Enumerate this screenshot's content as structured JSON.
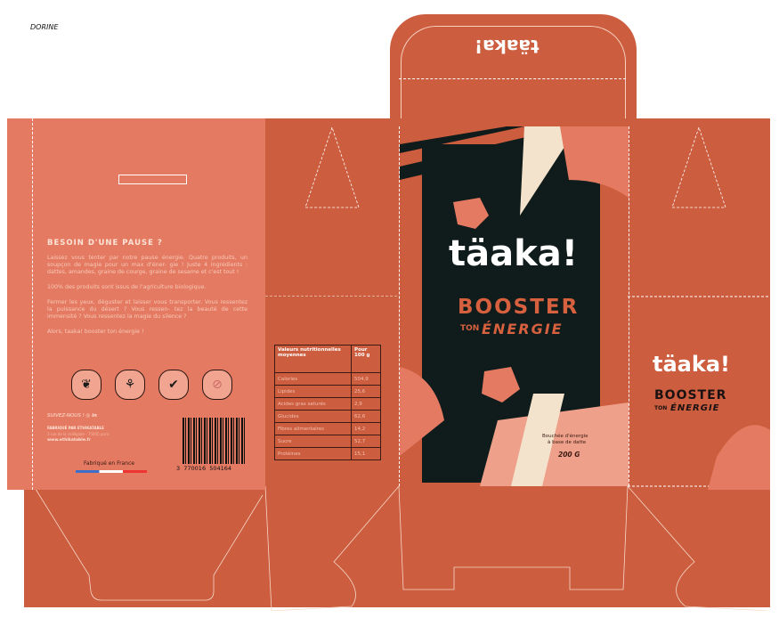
{
  "author": "DORINE",
  "colors": {
    "dieline": "#cc5d3e",
    "panel": "#e57a62",
    "dark": "#0f1c1b",
    "cream": "#f4e3cc",
    "pink": "#eea08a"
  },
  "back_panel": {
    "title": "BESOIN D'UNE PAUSE ?",
    "paragraphs": [
      "Laissez vous tenter par notre pause énergie. Quatre produits, un soupçon de magie pour un max d'éner- gie ! Juste 4 ingrédients : dattes, amandes, graine de courge, graine de sesame et c'est tout !",
      "100% des produits sont issus de l'agriculture biologique.",
      "Fermer les yeux, déguster et laisser vous transporter. Vous ressentez la puissance du désert ? Vous ressen- tez la beauté de cette immensité ? Vous ressentez la magie du silence ?",
      "Alors, taaka! booster ton énergie !"
    ],
    "badges": [
      {
        "icon": "vegan-leaf-icon",
        "label": "Vegan"
      },
      {
        "icon": "wheat-icon",
        "label": "Sans gluten"
      },
      {
        "icon": "check-icon",
        "label": "Biologique"
      },
      {
        "icon": "no-sugar-icon",
        "label": "Sans sucre ajouté"
      }
    ],
    "follow": "SUIVEZ-NOUS !",
    "maker": "FABRIQUÉ PAR ETHIKATABLE",
    "address": "3 rue de la collégiale - 75005 paris",
    "website": "www.ethikatable.fr",
    "made_in": "Fabriqué en France",
    "barcode": "3  770016  504164"
  },
  "nutrition": {
    "header": [
      "Valeurs nutritionnelles moyennes",
      "Pour 100 g"
    ],
    "rows": [
      [
        "Calories",
        "504,9"
      ],
      [
        "Lipides",
        "25,6"
      ],
      [
        "Acides gras saturés",
        "2,9"
      ],
      [
        "Glucides",
        "62,6"
      ],
      [
        "Fibres alimentaires",
        "14,2"
      ],
      [
        "Sucre",
        "52,7"
      ],
      [
        "Protéines",
        "15,1"
      ]
    ]
  },
  "front": {
    "logo": "täaka!",
    "booster": "BOOSTER",
    "ton": "TON",
    "energie": "ÉNERGIE",
    "desc1": "Bouchée d'énergie",
    "desc2": "à base de datte",
    "weight": "200 G"
  },
  "side": {
    "logo": "täaka!",
    "booster": "BOOSTER",
    "ton": "TON",
    "energie": "ÉNERGIE"
  },
  "top_flap": {
    "logo": "täaka!"
  }
}
